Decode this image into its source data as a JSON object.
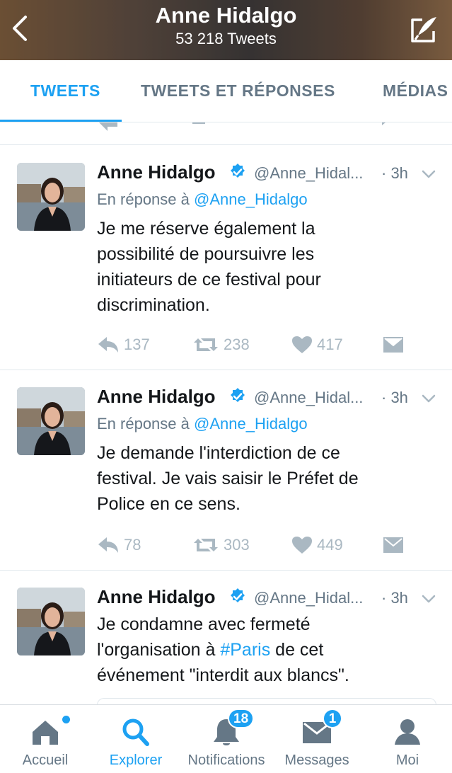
{
  "header": {
    "title": "Anne Hidalgo",
    "subtitle": "53 218 Tweets",
    "back_icon": "chevron-left-icon",
    "compose_icon": "compose-tweet-icon"
  },
  "tabs": [
    {
      "label": "TWEETS",
      "active": true
    },
    {
      "label": "TWEETS ET RÉPONSES",
      "active": false
    },
    {
      "label": "MÉDIAS",
      "active": false
    }
  ],
  "tweets": [
    {
      "name": "Anne Hidalgo",
      "handle": "@Anne_Hidal...",
      "time": "· 3h",
      "reply_prefix": "En réponse à",
      "reply_to": "@Anne_Hidalgo",
      "lines": [
        "Je me réserve également la",
        "possibilité de poursuivre les",
        "initiateurs de ce festival pour",
        "discrimination."
      ],
      "replies": "137",
      "retweets": "238",
      "likes": "417"
    },
    {
      "name": "Anne Hidalgo",
      "handle": "@Anne_Hidal...",
      "time": "· 3h",
      "reply_prefix": "En réponse à",
      "reply_to": "@Anne_Hidalgo",
      "lines": [
        "Je demande l'interdiction de ce",
        "festival. Je vais saisir le Préfet de",
        "Police en ce sens."
      ],
      "replies": "78",
      "retweets": "303",
      "likes": "449"
    },
    {
      "name": "Anne Hidalgo",
      "handle": "@Anne_Hidal...",
      "time": "· 3h",
      "line1": "Je condamne avec fermeté",
      "line2_before": "l'organisation à ",
      "hashtag": "#Paris",
      "line2_after": " de cet",
      "line3": "événement \"interdit aux blancs\"."
    }
  ],
  "bottom_nav": [
    {
      "label": "Accueil",
      "icon": "home-icon",
      "active": false,
      "dot": true
    },
    {
      "label": "Explorer",
      "icon": "search-icon",
      "active": true
    },
    {
      "label": "Notifications",
      "icon": "bell-icon",
      "active": false,
      "badge": "18"
    },
    {
      "label": "Messages",
      "icon": "envelope-icon",
      "active": false,
      "badge": "1"
    },
    {
      "label": "Moi",
      "icon": "profile-icon",
      "active": false
    }
  ],
  "colors": {
    "accent": "#1da1f2",
    "muted": "#657786",
    "icon_gray": "#aab8c2",
    "text": "#14171a"
  }
}
